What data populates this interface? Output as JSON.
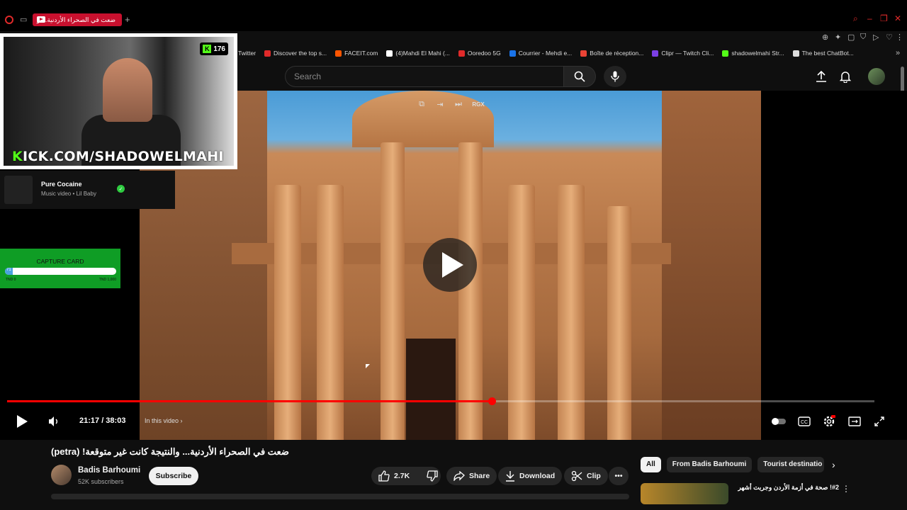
{
  "browser": {
    "tab_title": "ضعت في الصحراء الأردنية... و",
    "new_tab": "+",
    "bookmarks": [
      {
        "label": "Twitter",
        "color": "#1da1f2"
      },
      {
        "label": "Discover the top s...",
        "color": "#e02a2a"
      },
      {
        "label": "FACEIT.com",
        "color": "#ff5500"
      },
      {
        "label": "(4)Mahdi El Mahi (...",
        "color": "#ffffff"
      },
      {
        "label": "Ooredoo 5G",
        "color": "#e02a2a"
      },
      {
        "label": "Courrier - Mehdi e...",
        "color": "#1a73e8"
      },
      {
        "label": "Boîte de réception...",
        "color": "#ea4335"
      },
      {
        "label": "Clipr — Twitch Cli...",
        "color": "#7b3fe4"
      },
      {
        "label": "shadowelmahi Str...",
        "color": "#53fc18"
      },
      {
        "label": "The best ChatBot...",
        "color": "#dddddd"
      }
    ]
  },
  "youtube": {
    "search_placeholder": "Search",
    "video_title": "ضعت في الصحراء الأردنية... والنتيجة كانت غير متوقعة! (petra)",
    "time_current": "21:17",
    "time_total": "38:03",
    "time_display": "21:17 / 38:03",
    "progress_fraction": 0.559,
    "chapter_label": "In this video",
    "tool_rgx": "RGX",
    "channel": {
      "name": "Badis Barhoumi",
      "subscribers": "52K subscribers",
      "subscribe_label": "Subscribe"
    },
    "actions": {
      "likes": "2.7K",
      "share": "Share",
      "download": "Download",
      "clip": "Clip"
    },
    "chips": [
      "All",
      "From Badis Barhoumi",
      "Tourist destinatio"
    ],
    "recommendation": {
      "title": "#2! صحة في أزمة الأردن وجربت أشهر"
    }
  },
  "overlay": {
    "viewer_count": "176",
    "kick_url_first": "K",
    "kick_url_rest": "ICK.COM/SHADOWELMAHI",
    "now_playing": {
      "title": "Pure Cocaine",
      "subtitle": "Music video • Lil Baby"
    },
    "capture_card": {
      "label": "CAPTURE CARD",
      "min_label": "TND 0",
      "max_label": "TND 1,000",
      "current_label": "71",
      "fraction": 0.071
    }
  },
  "colors": {
    "accent": "#ff0000",
    "kick_green": "#53fc18",
    "opera_red": "#e02a2a"
  }
}
